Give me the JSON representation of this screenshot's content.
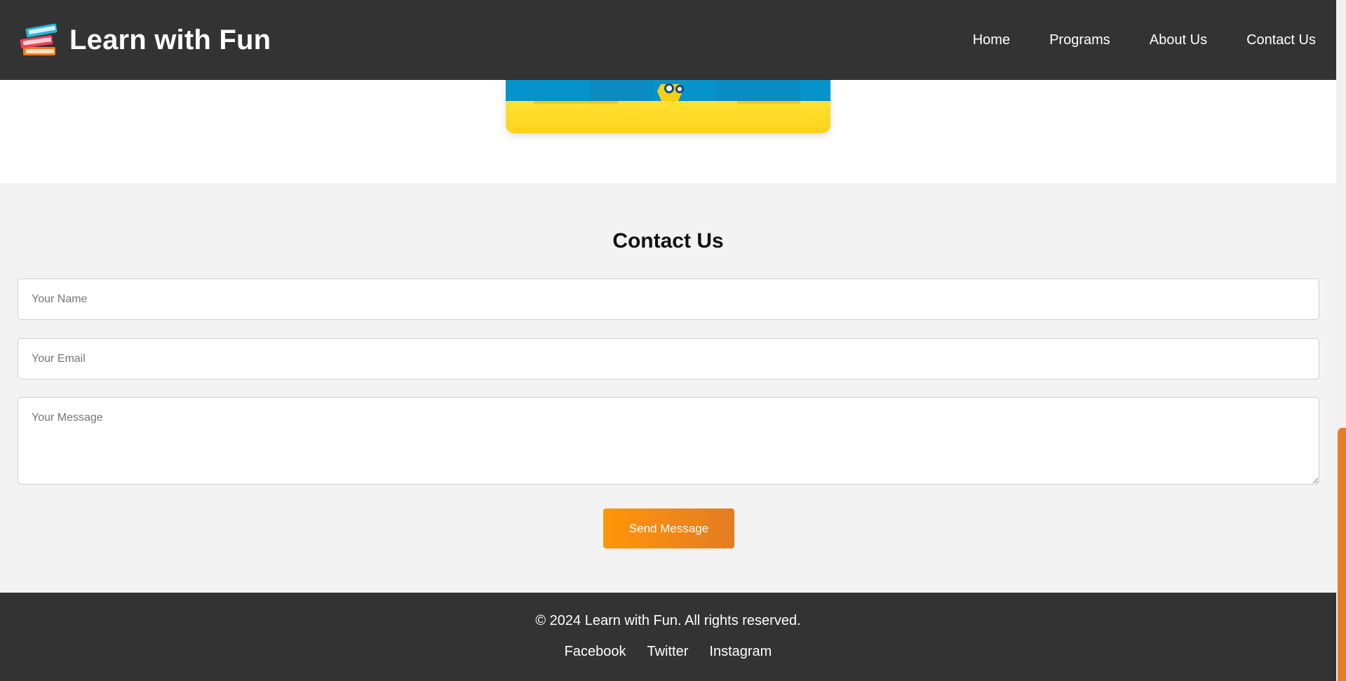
{
  "header": {
    "title": "Learn with Fun",
    "logo_icon": "stacked-books-icon",
    "nav": [
      {
        "label": "Home"
      },
      {
        "label": "Programs"
      },
      {
        "label": "About Us"
      },
      {
        "label": "Contact Us"
      }
    ]
  },
  "hero": {
    "image_icon": "cartoon-robot-icon"
  },
  "contact": {
    "title": "Contact Us",
    "name_placeholder": "Your Name",
    "name_value": "",
    "email_placeholder": "Your Email",
    "email_value": "",
    "message_placeholder": "Your Message",
    "message_value": "",
    "submit_label": "Send Message"
  },
  "footer": {
    "copyright": "© 2024 Learn with Fun. All rights reserved.",
    "links": [
      {
        "label": "Facebook"
      },
      {
        "label": "Twitter"
      },
      {
        "label": "Instagram"
      }
    ]
  },
  "colors": {
    "header_bg": "#333333",
    "contact_bg": "#f3f3f3",
    "accent": "#ff9607",
    "accent_end": "#e47c24",
    "scroll_thumb": "#e67e22"
  }
}
